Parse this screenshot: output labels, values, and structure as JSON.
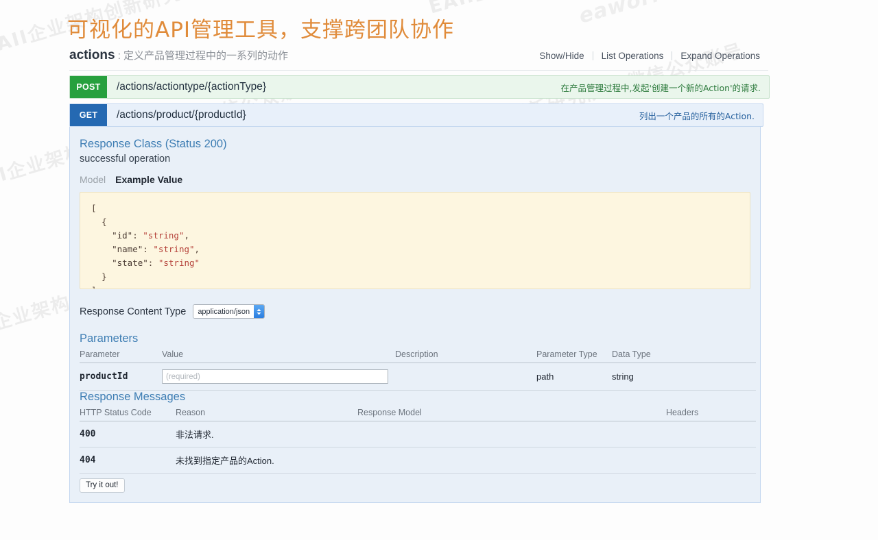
{
  "page": {
    "title": "可视化的API管理工具，支撑跨团队协作",
    "title_color": "#e08b3a",
    "background": "#fdfdfd"
  },
  "watermarks": {
    "chinese": "EAII企业架构创新研究院 · 微信公众账号",
    "english": "eaworld"
  },
  "resource": {
    "name": "actions",
    "separator": " : ",
    "description": "定义产品管理过程中的一系列的动作",
    "options": {
      "show_hide": "Show/Hide",
      "list_operations": "List Operations",
      "expand_operations": "Expand Operations"
    }
  },
  "operations": [
    {
      "verb": "POST",
      "verb_color": "#27a03e",
      "path": "/actions/actiontype/{actionType}",
      "summary": "在产品管理过程中,发起'创建一个新的Action'的请求.",
      "expanded": false
    },
    {
      "verb": "GET",
      "verb_color": "#2569b2",
      "path": "/actions/product/{productId}",
      "summary": "列出一个产品的所有的Action.",
      "expanded": true
    }
  ],
  "detail": {
    "response_class_title": "Response Class (Status 200)",
    "response_class_subtitle": "successful operation",
    "model_tab": "Model",
    "example_value_tab": "Example Value",
    "example_json": {
      "line1": "[",
      "line2": "{",
      "line3_key": "\"id\"",
      "line3_val": "\"string\"",
      "line4_key": "\"name\"",
      "line4_val": "\"string\"",
      "line5_key": "\"state\"",
      "line5_val": "\"string\"",
      "line6": "}",
      "line7": "]"
    },
    "response_content_type_label": "Response Content Type",
    "response_content_type_value": "application/json",
    "parameters": {
      "title": "Parameters",
      "headers": {
        "parameter": "Parameter",
        "value": "Value",
        "description": "Description",
        "parameter_type": "Parameter Type",
        "data_type": "Data Type"
      },
      "rows": [
        {
          "parameter": "productId",
          "value": "",
          "value_placeholder": "(required)",
          "description": "",
          "parameter_type": "path",
          "data_type": "string"
        }
      ]
    },
    "response_messages": {
      "title": "Response Messages",
      "headers": {
        "http_status_code": "HTTP Status Code",
        "reason": "Reason",
        "response_model": "Response Model",
        "headers": "Headers"
      },
      "rows": [
        {
          "code": "400",
          "reason": "非法请求.",
          "response_model": "",
          "headers": ""
        },
        {
          "code": "404",
          "reason": "未找到指定产品的Action.",
          "response_model": "",
          "headers": ""
        }
      ]
    },
    "try_it_out": "Try it out!"
  }
}
